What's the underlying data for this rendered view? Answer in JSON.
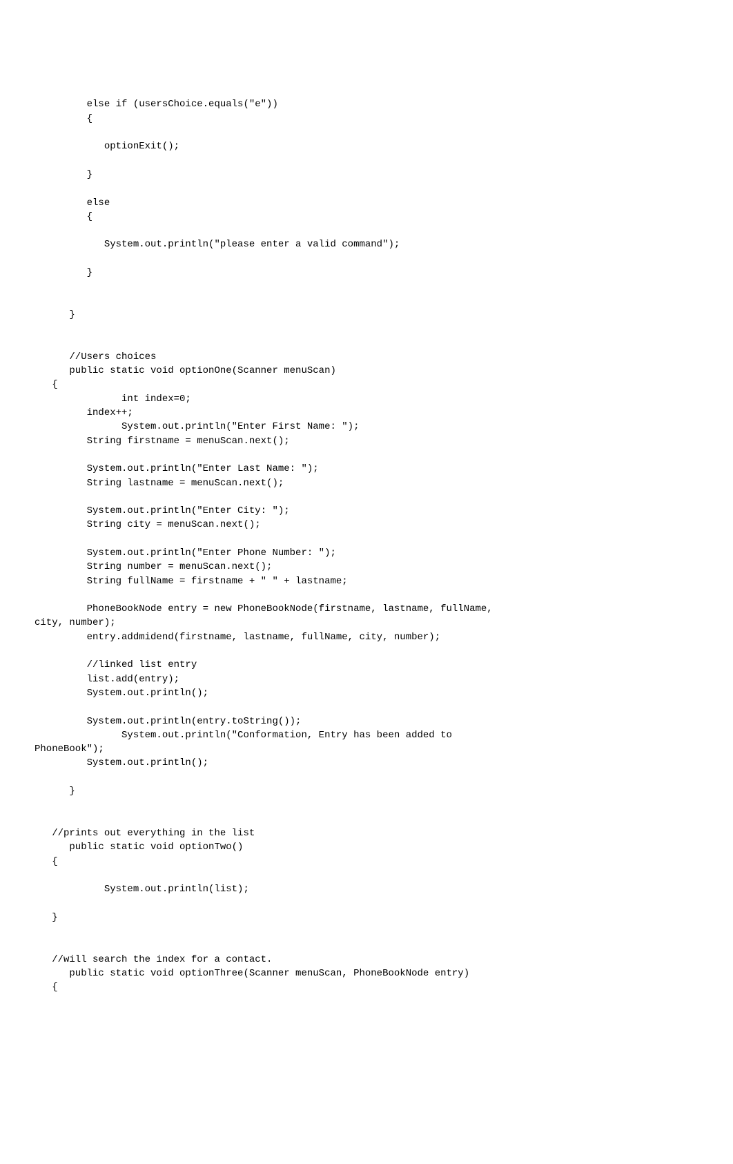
{
  "code": {
    "lines": [
      "",
      "         else if (usersChoice.equals(\"e\"))",
      "         {",
      "",
      "            optionExit();",
      "",
      "         }",
      "",
      "         else",
      "         {",
      "",
      "            System.out.println(\"please enter a valid command\");",
      "",
      "         }",
      "",
      "",
      "      }",
      "",
      "",
      "      //Users choices",
      "      public static void optionOne(Scanner menuScan)",
      "   {",
      "               int index=0;",
      "         index++;",
      "               System.out.println(\"Enter First Name: \");",
      "         String firstname = menuScan.next();",
      "",
      "         System.out.println(\"Enter Last Name: \");",
      "         String lastname = menuScan.next();",
      "",
      "         System.out.println(\"Enter City: \");",
      "         String city = menuScan.next();",
      "",
      "         System.out.println(\"Enter Phone Number: \");",
      "         String number = menuScan.next();",
      "         String fullName = firstname + \" \" + lastname;",
      "",
      "         PhoneBookNode entry = new PhoneBookNode(firstname, lastname, fullName,",
      "city, number);",
      "         entry.addmidend(firstname, lastname, fullName, city, number);",
      "",
      "         //linked list entry",
      "         list.add(entry);",
      "         System.out.println();",
      "",
      "         System.out.println(entry.toString());",
      "               System.out.println(\"Conformation, Entry has been added to",
      "PhoneBook\");",
      "         System.out.println();",
      "",
      "      }",
      "",
      "",
      "   //prints out everything in the list",
      "      public static void optionTwo()",
      "   {",
      "",
      "            System.out.println(list);",
      "",
      "   }",
      "",
      "",
      "   //will search the index for a contact.",
      "      public static void optionThree(Scanner menuScan, PhoneBookNode entry)",
      "   {"
    ]
  }
}
